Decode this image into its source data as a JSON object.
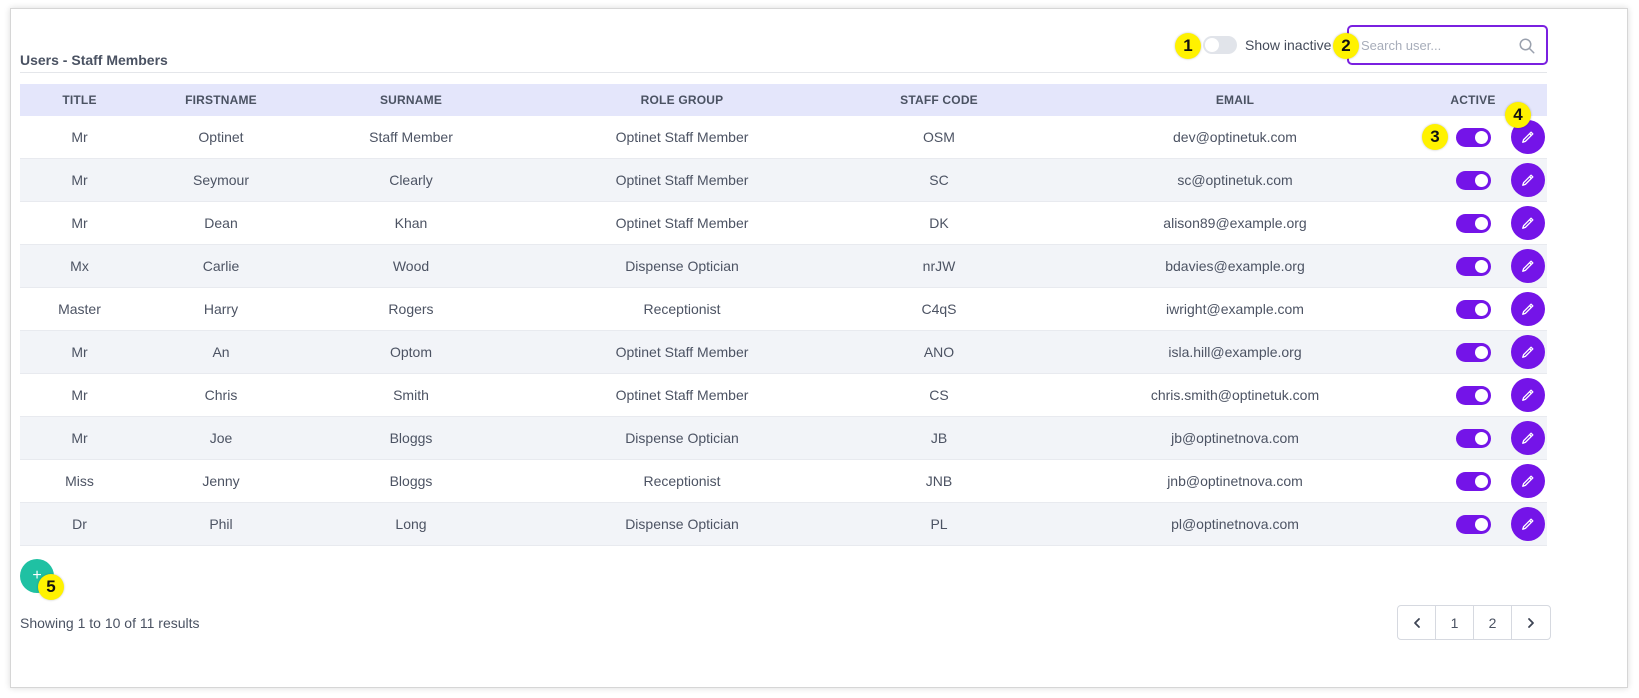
{
  "header": {
    "title": "Users - Staff Members",
    "show_inactive_label": "Show inactive",
    "search_placeholder": "Search user..."
  },
  "table": {
    "columns": [
      "TITLE",
      "FIRSTNAME",
      "SURNAME",
      "ROLE GROUP",
      "STAFF CODE",
      "EMAIL",
      "ACTIVE"
    ],
    "rows": [
      {
        "title": "Mr",
        "firstname": "Optinet",
        "surname": "Staff Member",
        "role": "Optinet Staff Member",
        "code": "OSM",
        "email": "dev@optinetuk.com",
        "active": true
      },
      {
        "title": "Mr",
        "firstname": "Seymour",
        "surname": "Clearly",
        "role": "Optinet Staff Member",
        "code": "SC",
        "email": "sc@optinetuk.com",
        "active": true
      },
      {
        "title": "Mr",
        "firstname": "Dean",
        "surname": "Khan",
        "role": "Optinet Staff Member",
        "code": "DK",
        "email": "alison89@example.org",
        "active": true
      },
      {
        "title": "Mx",
        "firstname": "Carlie",
        "surname": "Wood",
        "role": "Dispense Optician",
        "code": "nrJW",
        "email": "bdavies@example.org",
        "active": true
      },
      {
        "title": "Master",
        "firstname": "Harry",
        "surname": "Rogers",
        "role": "Receptionist",
        "code": "C4qS",
        "email": "iwright@example.com",
        "active": true
      },
      {
        "title": "Mr",
        "firstname": "An",
        "surname": "Optom",
        "role": "Optinet Staff Member",
        "code": "ANO",
        "email": "isla.hill@example.org",
        "active": true
      },
      {
        "title": "Mr",
        "firstname": "Chris",
        "surname": "Smith",
        "role": "Optinet Staff Member",
        "code": "CS",
        "email": "chris.smith@optinetuk.com",
        "active": true
      },
      {
        "title": "Mr",
        "firstname": "Joe",
        "surname": "Bloggs",
        "role": "Dispense Optician",
        "code": "JB",
        "email": "jb@optinetnova.com",
        "active": true
      },
      {
        "title": "Miss",
        "firstname": "Jenny",
        "surname": "Bloggs",
        "role": "Receptionist",
        "code": "JNB",
        "email": "jnb@optinetnova.com",
        "active": true
      },
      {
        "title": "Dr",
        "firstname": "Phil",
        "surname": "Long",
        "role": "Dispense Optician",
        "code": "PL",
        "email": "pl@optinetnova.com",
        "active": true
      }
    ]
  },
  "footer": {
    "add_label": "+",
    "results_text": "Showing 1 to 10 of 11 results",
    "pages": [
      "1",
      "2"
    ],
    "prev_icon": "chevron-left-icon",
    "next_icon": "chevron-right-icon"
  },
  "callouts": [
    "1",
    "2",
    "3",
    "4",
    "5"
  ],
  "colors": {
    "accent": "#7414e8",
    "add_button": "#1fc1a3",
    "header_bg": "#e4e6fb",
    "callout": "#fff200"
  }
}
